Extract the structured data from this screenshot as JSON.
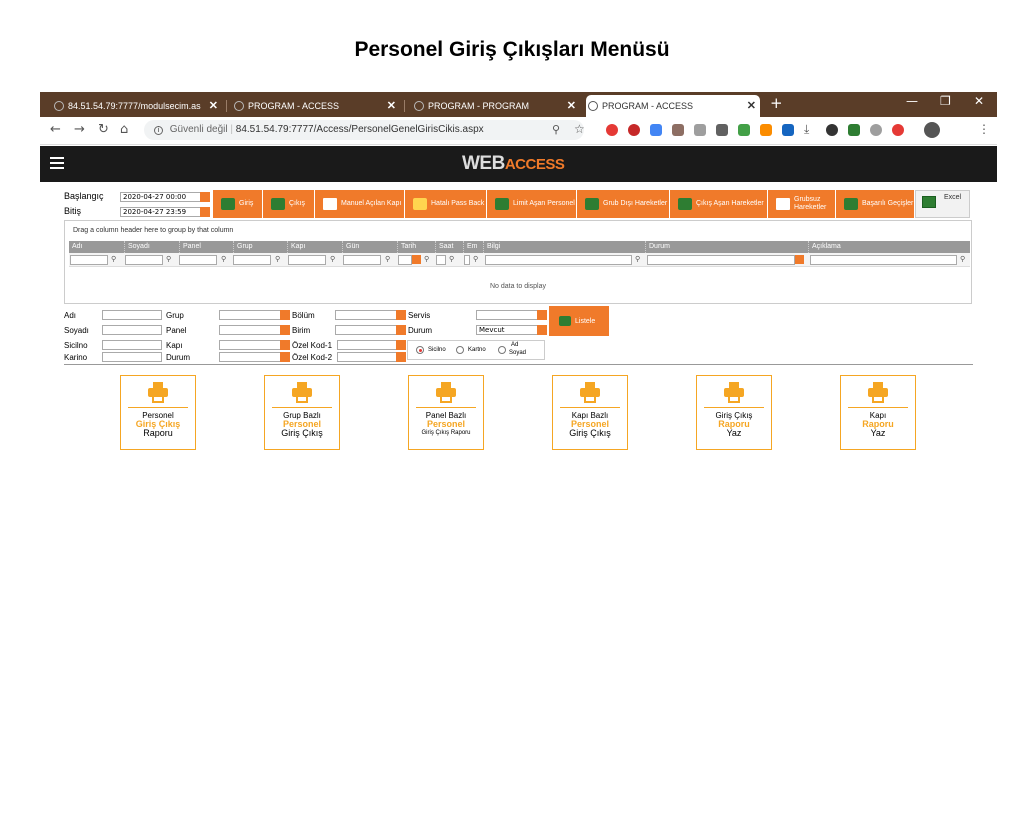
{
  "document_title": "Personel Giriş Çıkışları Menüsü",
  "browser": {
    "tabs": [
      {
        "title": "84.51.54.79:7777/modulsecim.as",
        "active": false
      },
      {
        "title": "PROGRAM - ACCESS",
        "active": false
      },
      {
        "title": "PROGRAM - PROGRAM",
        "active": false
      },
      {
        "title": "PROGRAM - ACCESS",
        "active": true
      }
    ],
    "security_label": "Güvenli değil",
    "url": "84.51.54.79:7777/Access/PersonelGenelGirisCikis.aspx"
  },
  "app": {
    "logo_main": "WEB",
    "logo_accent": "ACCESS"
  },
  "dates": {
    "start_label": "Başlangıç",
    "start_value": "2020-04-27 00:00",
    "end_label": "Bitiş",
    "end_value": "2020-04-27 23:59"
  },
  "toolbar": [
    {
      "label": "Giriş",
      "icon": "users-in-icon"
    },
    {
      "label": "Çıkış",
      "icon": "users-out-icon"
    },
    {
      "label": "Manuel Açılan Kapı",
      "icon": "door-icon"
    },
    {
      "label": "Hatalı Pass Back",
      "icon": "error-icon"
    },
    {
      "label": "Limit Aşan Personel",
      "icon": "limit-icon"
    },
    {
      "label": "Grub Dışı Hareketler",
      "icon": "group-out-icon"
    },
    {
      "label": "Çıkış Aşan Hareketler",
      "icon": "exit-over-icon"
    },
    {
      "label": "Grubsuz Hareketler",
      "icon": "no-group-icon"
    },
    {
      "label": "Başarılı Geçişler",
      "icon": "success-icon"
    }
  ],
  "excel_label": "Excel",
  "grid": {
    "group_hint": "Drag a column header here to group by that column",
    "columns": [
      "Adı",
      "Soyadı",
      "Panel",
      "Grup",
      "Kapı",
      "Gün",
      "Tarih",
      "Saat",
      "Em",
      "Bilgi",
      "Durum",
      "Açıklama"
    ],
    "empty_text": "No data to display"
  },
  "filters": {
    "adi": "Adı",
    "soyadi": "Soyadı",
    "sicilno": "Sicilno",
    "karino": "Karino",
    "grup": "Grup",
    "panel": "Panel",
    "kapi": "Kapı",
    "durum": "Durum",
    "bolum": "Bölüm",
    "birim": "Birim",
    "ozel1": "Özel Kod-1",
    "ozel2": "Özel Kod-2",
    "servis": "Servis",
    "durum2": "Durum",
    "durum2_value": "Mevcut",
    "list_button": "Listele",
    "radio_sicilno": "Sicilno",
    "radio_kartno": "Kartno",
    "radio_adsoyad_1": "Ad",
    "radio_adsoyad_2": "Soyad"
  },
  "reports": [
    {
      "l1": "Personel",
      "l2": "Giriş Çıkış",
      "l3": "Raporu"
    },
    {
      "l1": "Grup Bazlı",
      "l2": "Personel",
      "l3": "Giriş Çıkış"
    },
    {
      "l1": "Panel Bazlı",
      "l2": "Personel",
      "l3": "Giriş Çıkış Raporu"
    },
    {
      "l1": "Kapı Bazlı",
      "l2": "Personel",
      "l3": "Giriş Çıkış"
    },
    {
      "l1": "Giriş Çıkış",
      "l2": "Raporu",
      "l3": "Yaz"
    },
    {
      "l1": "Kapı",
      "l2": "Raporu",
      "l3": "Yaz"
    }
  ]
}
